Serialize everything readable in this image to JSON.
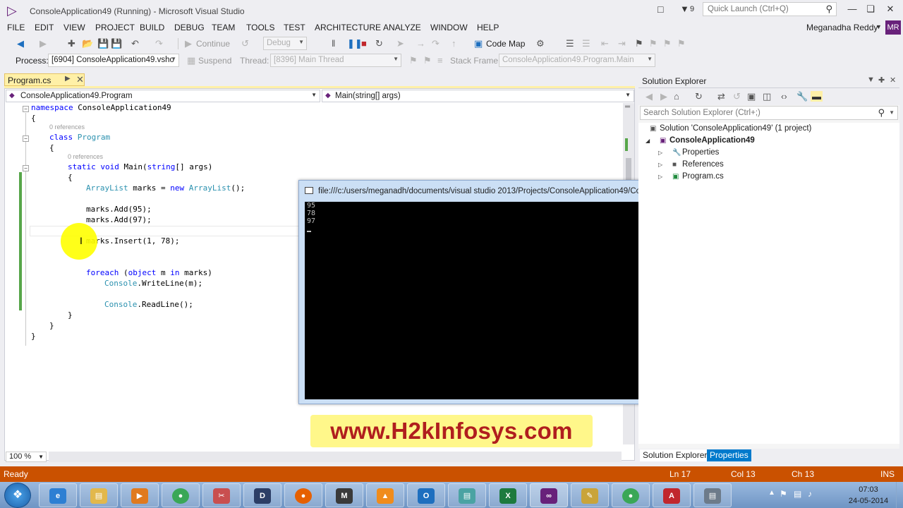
{
  "window": {
    "title": "ConsoleApplication49 (Running) - Microsoft Visual Studio",
    "notification_count": "9",
    "quick_launch_placeholder": "Quick Launch (Ctrl+Q)",
    "user_name": "Meganadha Reddy",
    "avatar_initials": "MR"
  },
  "menu": [
    "FILE",
    "EDIT",
    "VIEW",
    "PROJECT",
    "BUILD",
    "DEBUG",
    "TEAM",
    "TOOLS",
    "TEST",
    "ARCHITECTURE",
    "ANALYZE",
    "WINDOW",
    "HELP"
  ],
  "toolbar": {
    "continue_label": "Continue",
    "config_value": "Debug",
    "code_map_label": "Code Map",
    "process_label": "Process:",
    "process_value": "[6904] ConsoleApplication49.vsho",
    "suspend_label": "Suspend",
    "thread_label": "Thread:",
    "thread_value": "[8396] Main Thread",
    "stack_frame_label": "Stack Frame:",
    "stack_frame_value": "ConsoleApplication49.Program.Main"
  },
  "editor": {
    "tab_label": "Program.cs",
    "nav_class": "ConsoleApplication49.Program",
    "nav_method": "Main(string[] args)",
    "zoom": "100 %",
    "refs_label": "0 references",
    "code": {
      "l1_kw": "namespace",
      "l1_rest": " ConsoleApplication49",
      "brace_open": "{",
      "brace_close": "}",
      "l3_kw": "class",
      "l3_ty": " Program",
      "l5_kw1": "static",
      "l5_kw2": " void",
      "l5_rest1": " Main(",
      "l5_kw3": "string",
      "l5_rest2": "[] args)",
      "l7_ty1": "ArrayList",
      "l7_rest1": " marks = ",
      "l7_kw": "new",
      "l7_ty2": " ArrayList",
      "l7_rest2": "();",
      "l8": "marks.Add(95);",
      "l9": "marks.Add(97);",
      "l11": "marks.Insert(1, 78);",
      "l13_kw1": "foreach",
      "l13_rest1": " (",
      "l13_kw2": "object",
      "l13_rest2": " m ",
      "l13_kw3": "in",
      "l13_rest3": " marks)",
      "l14_ty": "Console",
      "l14_rest": ".WriteLine(m);",
      "l16_ty": "Console",
      "l16_rest": ".ReadLine();"
    }
  },
  "console": {
    "title": "file:///c:/users/meganadh/documents/visual studio 2013/Projects/ConsoleApplication49/ConsoleA...",
    "lines": [
      "95",
      "78",
      "97"
    ]
  },
  "watermark": "www.H2kInfosys.com",
  "solution_explorer": {
    "title": "Solution Explorer",
    "search_placeholder": "Search Solution Explorer (Ctrl+;)",
    "tree": {
      "solution": "Solution 'ConsoleApplication49' (1 project)",
      "project": "ConsoleApplication49",
      "properties": "Properties",
      "references": "References",
      "program": "Program.cs"
    },
    "tab_active": "Solution Explorer",
    "tab_properties": "Properties"
  },
  "statusbar": {
    "status": "Ready",
    "line": "Ln 17",
    "col": "Col 13",
    "ch": "Ch 13",
    "mode": "INS"
  },
  "taskbar": {
    "time": "07:03",
    "date": "24-05-2014"
  },
  "colors": {
    "status_bar": "#ca5100",
    "vs_purple": "#68217a",
    "tab_active": "#fff0a7",
    "properties_tab": "#007acc",
    "watermark_text": "#b01e1e",
    "watermark_bg": "#fff78a"
  }
}
